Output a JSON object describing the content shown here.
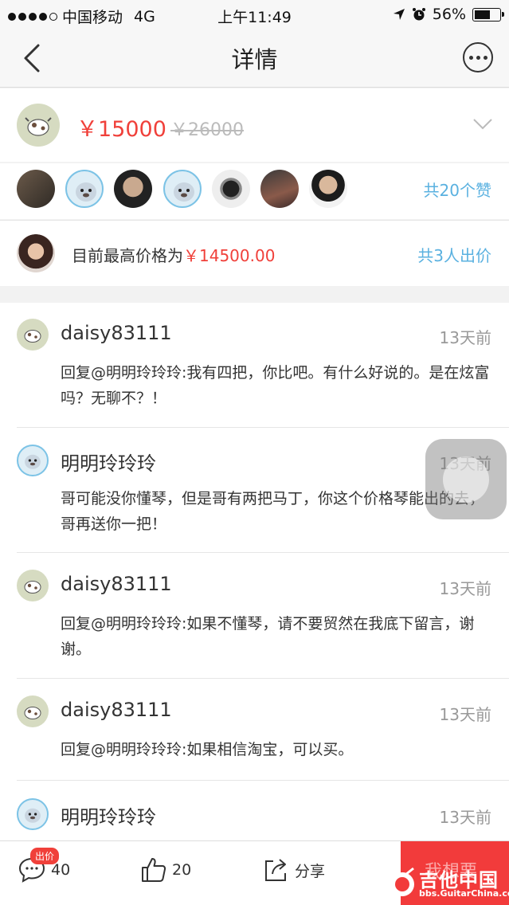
{
  "status_bar": {
    "carrier": "中国移动",
    "network": "4G",
    "time": "上午11:49",
    "battery": "56%"
  },
  "nav": {
    "title": "详情"
  },
  "listing": {
    "price": "￥15000",
    "original_price": "￥26000"
  },
  "likes": {
    "count_text": "共20个赞",
    "avatars": [
      "avatar-1",
      "avatar-2",
      "avatar-3",
      "avatar-4",
      "avatar-5",
      "avatar-6",
      "avatar-7"
    ]
  },
  "bids": {
    "highest_label": "目前最高价格为",
    "highest_value": "￥14500.00",
    "count_text": "共3人出价"
  },
  "comments": [
    {
      "user": "daisy83111",
      "time": "13天前",
      "text": "回复@明明玲玲玲:我有四把，你比吧。有什么好说的。是在炫富吗？无聊不？！",
      "avatar": "cow"
    },
    {
      "user": "明明玲玲玲",
      "time": "13天前",
      "text": "哥可能没你懂琴，但是哥有两把马丁，你这个价格琴能出的去，哥再送你一把！",
      "avatar": "seal"
    },
    {
      "user": "daisy83111",
      "time": "13天前",
      "text": "回复@明明玲玲玲:如果不懂琴，请不要贸然在我底下留言，谢谢。",
      "avatar": "cow"
    },
    {
      "user": "daisy83111",
      "time": "13天前",
      "text": "回复@明明玲玲玲:如果相信淘宝，可以买。",
      "avatar": "cow"
    },
    {
      "user": "明明玲玲玲",
      "time": "13天前",
      "text": "",
      "avatar": "seal"
    }
  ],
  "toolbar": {
    "badge": "出价",
    "comment_count": "40",
    "like_count": "20",
    "share_label": "分享",
    "action_label": "我想要"
  },
  "watermark": {
    "line1": "吉他中国",
    "line2": "bbs.GuitarChina.com"
  }
}
